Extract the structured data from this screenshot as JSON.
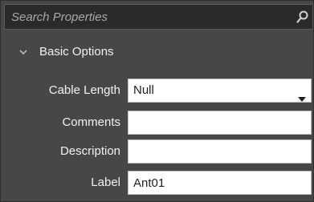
{
  "search": {
    "placeholder": "Search Properties",
    "icon": "search-icon"
  },
  "group": {
    "title": "Basic Options",
    "expanded": true,
    "icon": "chevron-down-icon"
  },
  "properties": {
    "cable_length": {
      "label": "Cable Length",
      "value": "Null"
    },
    "comments": {
      "label": "Comments",
      "value": ""
    },
    "description": {
      "label": "Description",
      "value": ""
    },
    "label": {
      "label": "Label",
      "value": "Ant01"
    }
  }
}
